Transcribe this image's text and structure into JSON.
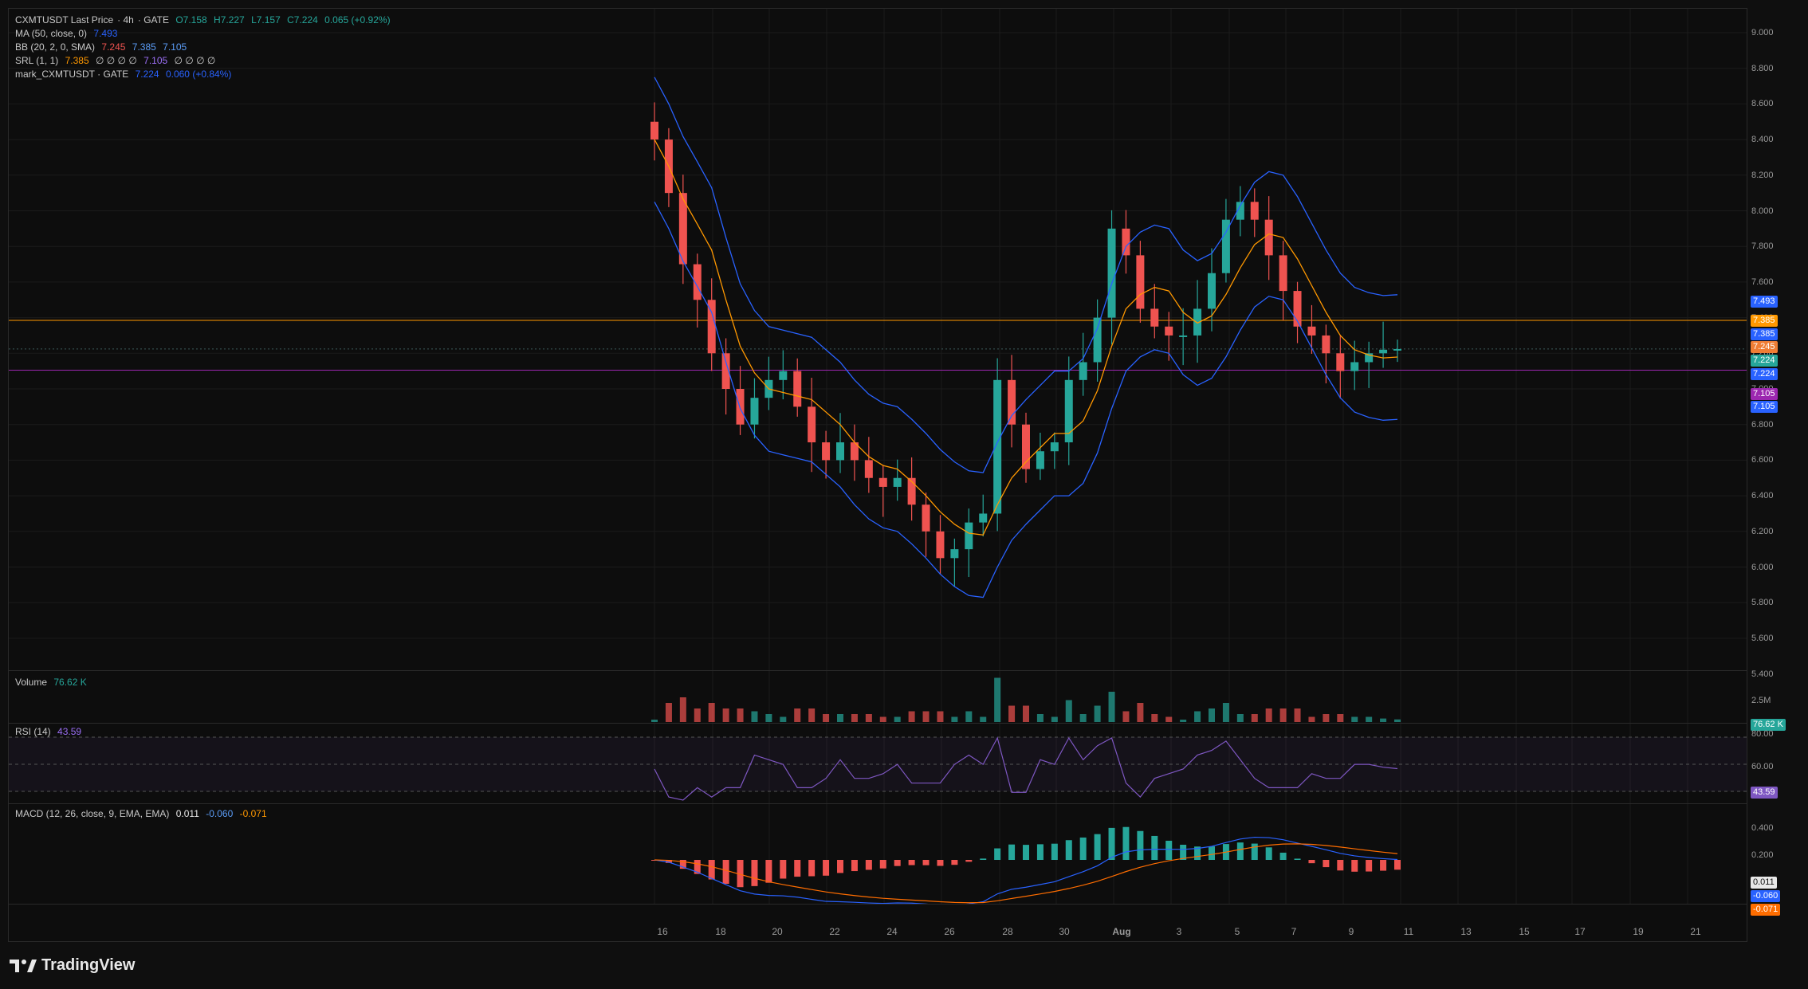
{
  "header": {
    "symbol": "CXMTUSDT Last Price",
    "interval": "4h",
    "exchange": "GATE",
    "open": "O7.158",
    "high": "H7.227",
    "low": "L7.157",
    "close": "C7.224",
    "change": "0.065 (+0.92%)"
  },
  "indicators": {
    "ma": {
      "label": "MA (50, close, 0)",
      "value": "7.493"
    },
    "bb": {
      "label": "BB (20, 2, 0, SMA)",
      "basis": "7.245",
      "upper": "7.385",
      "lower": "7.105"
    },
    "srl": {
      "label": "SRL (1, 1)",
      "v1": "7.385",
      "nulls1": "∅ ∅ ∅ ∅",
      "v2": "7.105",
      "nulls2": "∅ ∅ ∅ ∅"
    },
    "mark": {
      "label": "mark_CXMTUSDT · GATE",
      "value": "7.224",
      "change": "0.060 (+0.84%)"
    },
    "volume": {
      "label": "Volume",
      "value": "76.62 K"
    },
    "rsi": {
      "label": "RSI (14)",
      "value": "43.59"
    },
    "macd": {
      "label": "MACD (12, 26, close, 9, EMA, EMA)",
      "hist": "0.011",
      "macd": "-0.060",
      "signal": "-0.071"
    }
  },
  "price_axis": [
    "9.000",
    "8.800",
    "8.600",
    "8.400",
    "8.200",
    "8.000",
    "7.800",
    "7.600",
    "7.400",
    "7.200",
    "7.000",
    "6.800",
    "6.600",
    "6.400",
    "6.200",
    "6.000",
    "5.800",
    "5.600",
    "5.400"
  ],
  "price_tags": [
    {
      "text": "7.493",
      "color": "#2962ff",
      "y": 7.493
    },
    {
      "text": "7.385",
      "color": "#ff9800",
      "y": 7.385
    },
    {
      "text": "7.385",
      "color": "#2962ff",
      "y": 7.31
    },
    {
      "text": "7.245",
      "color": "#ef7d34",
      "y": 7.235
    },
    {
      "text": "7.224",
      "color": "#26a69a",
      "y": 7.16
    },
    {
      "text": "7.224",
      "color": "#2962ff",
      "y": 7.085
    },
    {
      "text": "7.105",
      "color": "#9c27b0",
      "y": 6.975
    },
    {
      "text": "7.105",
      "color": "#2962ff",
      "y": 6.9
    }
  ],
  "volume_axis": {
    "tick": "2.5M",
    "tag": "76.62 K"
  },
  "rsi_axis": {
    "top": "80.00",
    "mid": "60.00",
    "tag": "43.59"
  },
  "macd_axis": {
    "top": "0.400",
    "mid": "0.200",
    "tag_hist": "0.011",
    "tag_macd": "-0.060",
    "tag_signal": "-0.071"
  },
  "time_axis": [
    "16",
    "18",
    "20",
    "22",
    "24",
    "26",
    "28",
    "30",
    "Aug",
    "3",
    "5",
    "7",
    "9",
    "11",
    "13",
    "15",
    "17",
    "19",
    "21"
  ],
  "brand": "TradingView",
  "colors": {
    "up": "#26a69a",
    "down": "#ef5350",
    "bb": "#2962ff",
    "ma": "#ff9800",
    "srl_high": "#ff9800",
    "srl_low": "#9c27b0"
  },
  "chart_data": {
    "type": "line",
    "series": [
      {
        "name": "CXMTUSDT Last Price",
        "values": [
          8.4,
          8.1,
          7.7,
          7.5,
          7.2,
          7.0,
          6.8,
          6.95,
          7.05,
          7.1,
          6.9,
          6.7,
          6.6,
          6.7,
          6.6,
          6.5,
          6.45,
          6.5,
          6.35,
          6.2,
          6.05,
          6.1,
          6.25,
          6.3,
          7.05,
          6.8,
          6.55,
          6.65,
          6.7,
          7.05,
          7.15,
          7.4,
          7.9,
          7.75,
          7.45,
          7.35,
          7.3,
          7.3,
          7.45,
          7.65,
          7.95,
          8.05,
          7.95,
          7.75,
          7.55,
          7.35,
          7.3,
          7.2,
          7.1,
          7.15,
          7.2,
          7.22,
          7.224
        ]
      }
    ],
    "ylim": [
      5.4,
      9.0
    ]
  }
}
